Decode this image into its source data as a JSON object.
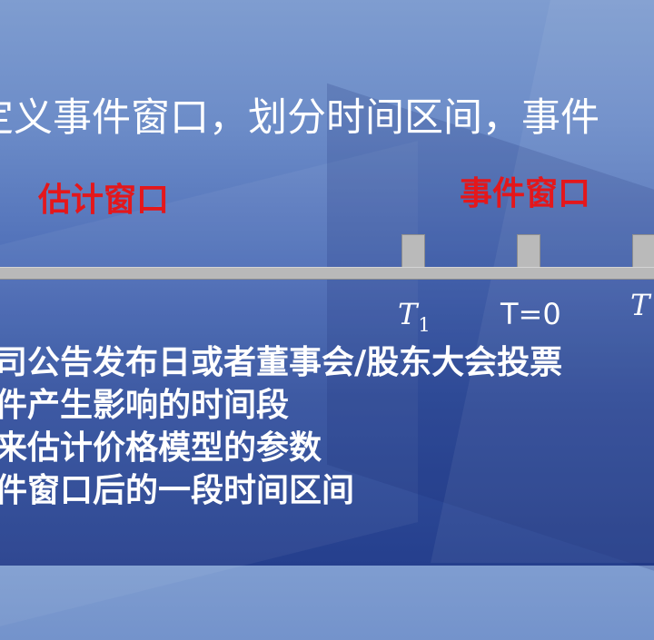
{
  "heading": "定义事件窗口，划分时间区间，事件",
  "labels": {
    "estimation_window": "估计窗口",
    "event_window": "事件窗口"
  },
  "timeline": {
    "ticks": {
      "t1": "T",
      "t1_sub": "1",
      "t0": "T=0",
      "t2": "T"
    }
  },
  "bullets": [
    "司公告发布日或者董事会/股东大会投票",
    "件产生影响的时间段",
    "来估计价格模型的参数",
    "件窗口后的一段时间区间"
  ]
}
